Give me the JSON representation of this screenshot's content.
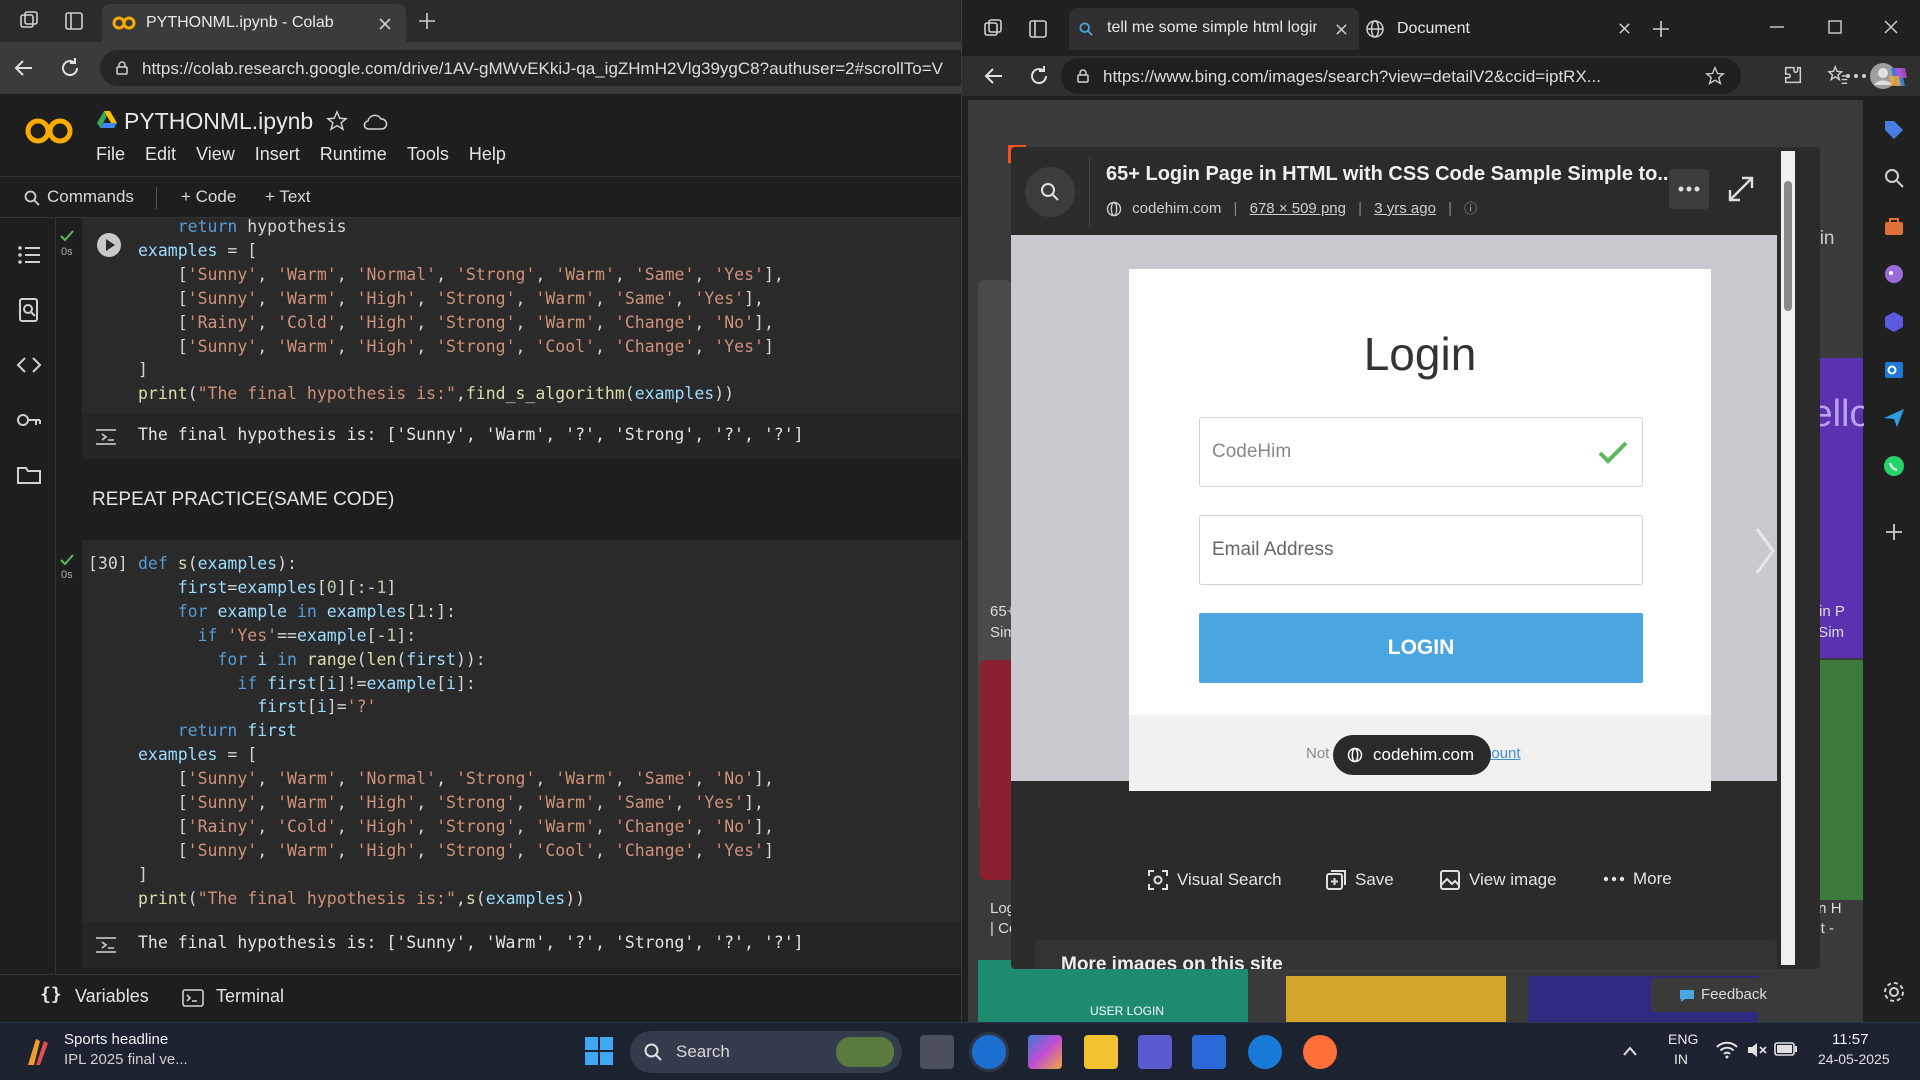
{
  "left_window": {
    "tab_title": "PYTHONML.ipynb - Colab",
    "url": "https://colab.research.google.com/drive/1AV-gMWvEKkiJ-qa_igZHmH2Vlg39ygC8?authuser=2#scrollTo=V",
    "notebook_title": "PYTHONML.ipynb",
    "menu": [
      "File",
      "Edit",
      "View",
      "Insert",
      "Runtime",
      "Tools",
      "Help"
    ],
    "toolbar": {
      "commands": "Commands",
      "code": "+ Code",
      "text": "+ Text"
    },
    "cell1": {
      "status_time": "0s",
      "lines": [
        "    return hypothesis",
        "examples = [",
        "    ['Sunny', 'Warm', 'Normal', 'Strong', 'Warm', 'Same', 'Yes'],",
        "    ['Sunny', 'Warm', 'High', 'Strong', 'Warm', 'Same', 'Yes'],",
        "    ['Rainy', 'Cold', 'High', 'Strong', 'Warm', 'Change', 'No'],",
        "    ['Sunny', 'Warm', 'High', 'Strong', 'Cool', 'Change', 'Yes']",
        "]",
        "print(\"The final hypothesis is:\",find_s_algorithm(examples))"
      ],
      "output": "The final hypothesis is: ['Sunny', 'Warm', '?', 'Strong', '?', '?']"
    },
    "text_cell": "REPEAT PRACTICE(SAME CODE)",
    "cell2": {
      "exec_count": "[30]",
      "status_time": "0s",
      "lines": [
        "def s(examples):",
        "    first=examples[0][:-1]",
        "    for example in examples[1:]:",
        "      if 'Yes'==example[-1]:",
        "        for i in range(len(first)):",
        "          if first[i]!=example[i]:",
        "            first[i]='?'",
        "    return first",
        "examples = [",
        "    ['Sunny', 'Warm', 'Normal', 'Strong', 'Warm', 'Same', 'No'],",
        "    ['Sunny', 'Warm', 'High', 'Strong', 'Warm', 'Same', 'Yes'],",
        "    ['Rainy', 'Cold', 'High', 'Strong', 'Warm', 'Change', 'No'],",
        "    ['Sunny', 'Warm', 'High', 'Strong', 'Cool', 'Change', 'Yes']",
        "]",
        "print(\"The final hypothesis is:\",s(examples))"
      ],
      "output": "The final hypothesis is: ['Sunny', 'Warm', '?', 'Strong', '?', '?']"
    },
    "bottom": {
      "variables": "Variables",
      "terminal": "Terminal"
    }
  },
  "right_window": {
    "tab1_title": "tell me some simple html login p",
    "tab2_title": "Document",
    "url": "https://www.bing.com/images/search?view=detailV2&ccid=iptRX...",
    "modal": {
      "title": "65+ Login Page in HTML with CSS Code Sample Simple to...",
      "site": "codehim.com",
      "size": "678 × 509 png",
      "age": "3 yrs ago",
      "preview": {
        "heading": "Login",
        "username_value": "CodeHim",
        "email_placeholder": "Email Address",
        "button": "LOGIN",
        "not_member": "Not a member?",
        "create_account": "Create Account",
        "watermark": "codehim.com"
      },
      "actions": [
        "Visual Search",
        "Save",
        "View image",
        "More"
      ],
      "more_images": "More images on this site"
    },
    "background": {
      "left_captions": [
        "65+",
        "Sim",
        "Log",
        "| Co"
      ],
      "right_captions": [
        "Login P",
        "ple Sim",
        "ge in H",
        "ficult -"
      ],
      "search_hint": "Login",
      "hello_text": "Hello Wor",
      "bottom_card": "USER LOGIN",
      "feedback": "Feedback"
    }
  },
  "taskbar": {
    "news_title": "Sports headline",
    "news_sub": "IPL 2025 final ve...",
    "search": "Search",
    "lang1": "ENG",
    "lang2": "IN",
    "time": "11:57",
    "date": "24-05-2025"
  },
  "colors": {
    "colab_orange": "#f9ab00",
    "login_blue": "#4aa5e0",
    "check_green": "#5cb85c",
    "link_blue": "#3f8fd2"
  }
}
